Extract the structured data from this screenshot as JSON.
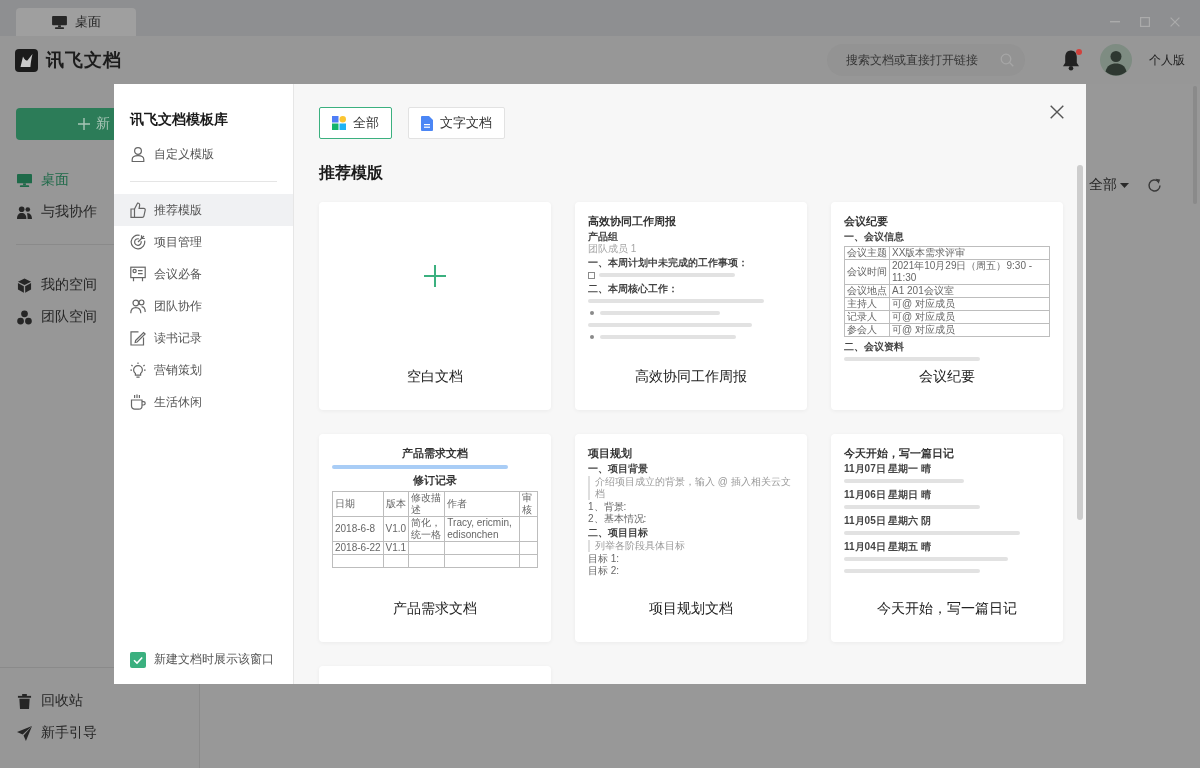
{
  "window": {
    "tab": {
      "label": "桌面"
    }
  },
  "header": {
    "app_name": "讯飞文档",
    "search": {
      "placeholder": "搜索文档或直接打开链接"
    },
    "notifications": {
      "unread": true
    },
    "account": "个人版"
  },
  "sidebar": {
    "new_button": {
      "label": "新"
    },
    "nav": [
      {
        "label": "桌面",
        "selected": true
      },
      {
        "label": "与我协作",
        "selected": false
      }
    ],
    "spaces": [
      {
        "label": "我的空间",
        "selected": false
      },
      {
        "label": "团队空间",
        "selected": false
      }
    ],
    "footer": [
      {
        "label": "回收站"
      },
      {
        "label": "新手引导"
      }
    ]
  },
  "main": {
    "filter": {
      "label": "全部"
    }
  },
  "dialog": {
    "title": "讯飞文档模板库",
    "custom": {
      "label": "自定义模版"
    },
    "categories": [
      {
        "label": "推荐模版",
        "selected": true
      },
      {
        "label": "项目管理",
        "selected": false
      },
      {
        "label": "会议必备",
        "selected": false
      },
      {
        "label": "团队协作",
        "selected": false
      },
      {
        "label": "读书记录",
        "selected": false
      },
      {
        "label": "营销策划",
        "selected": false
      },
      {
        "label": "生活休闲",
        "selected": false
      }
    ],
    "show_on_new": {
      "label": "新建文档时展示该窗口",
      "checked": true
    },
    "tabs": [
      {
        "label": "全部",
        "selected": true
      },
      {
        "label": "文字文档",
        "selected": false
      }
    ],
    "section_title": "推荐模版",
    "templates": [
      {
        "kind": "blank",
        "name": "空白文档"
      },
      {
        "kind": "doc",
        "name": "高效协同工作周报",
        "preview": [
          {
            "kind": "title",
            "text": "高效协同工作周报"
          },
          {
            "kind": "heading",
            "text": "产品组"
          },
          {
            "kind": "muted",
            "text": "团队成员 1"
          },
          {
            "kind": "heading",
            "text": "一、本周计划中未完成的工作事项："
          },
          {
            "kind": "check-bar"
          },
          {
            "kind": "heading",
            "text": "二、本周核心工作："
          },
          {
            "kind": "bar"
          },
          {
            "kind": "bullet-bar"
          },
          {
            "kind": "bar"
          },
          {
            "kind": "bullet-bar"
          }
        ]
      },
      {
        "kind": "doc",
        "name": "会议纪要",
        "preview": [
          {
            "kind": "title",
            "text": "会议纪要"
          },
          {
            "kind": "heading",
            "text": "一、会议信息"
          },
          {
            "kind": "table",
            "rows": [
              [
                "会议主题",
                "XX版本需求评审"
              ],
              [
                "会议时间",
                "2021年10月29日（周五）9:30 - 11:30"
              ],
              [
                "会议地点",
                "A1 201会议室"
              ],
              [
                "主持人",
                "可@ 对应成员"
              ],
              [
                "记录人",
                "可@ 对应成员"
              ],
              [
                "参会人",
                "可@ 对应成员"
              ]
            ]
          },
          {
            "kind": "heading",
            "text": "二、会议资料"
          },
          {
            "kind": "bar"
          }
        ]
      },
      {
        "kind": "doc",
        "name": "产品需求文档",
        "preview": [
          {
            "kind": "title-center",
            "text": "产品需求文档"
          },
          {
            "kind": "note-bar"
          },
          {
            "kind": "title-center",
            "text": "修订记录"
          },
          {
            "kind": "table",
            "rows": [
              [
                "日期",
                "版本",
                "修改描述",
                "作者",
                "审核"
              ],
              [
                "2018-6-8",
                "V1.0",
                "简化，统一格",
                "Tracy, ericmin, edisonchen",
                null
              ],
              [
                "2018-6-22",
                "V1.1",
                null,
                null,
                null
              ],
              [
                null,
                null,
                null,
                null,
                null
              ]
            ]
          }
        ]
      },
      {
        "kind": "doc",
        "name": "项目规划文档",
        "preview": [
          {
            "kind": "title",
            "text": "项目规划"
          },
          {
            "kind": "heading",
            "text": "一、项目背景"
          },
          {
            "kind": "quote",
            "text": "介绍项目成立的背景，输入 @ 插入相关云文档"
          },
          {
            "kind": "text",
            "text": "1、背景:"
          },
          {
            "kind": "text",
            "text": "2、基本情况:"
          },
          {
            "kind": "heading",
            "text": "二、项目目标"
          },
          {
            "kind": "quote",
            "text": "列举各阶段具体目标"
          },
          {
            "kind": "text",
            "text": "目标 1:"
          },
          {
            "kind": "text",
            "text": "目标 2:"
          }
        ]
      },
      {
        "kind": "doc",
        "name": "今天开始，写一篇日记",
        "preview": [
          {
            "kind": "title",
            "text": "今天开始，写一篇日记"
          },
          {
            "kind": "heading",
            "text": "11月07日 星期一 晴"
          },
          {
            "kind": "bar"
          },
          {
            "kind": "heading",
            "text": "11月06日 星期日 晴"
          },
          {
            "kind": "bar"
          },
          {
            "kind": "heading",
            "text": "11月05日 星期六 阴"
          },
          {
            "kind": "bar"
          },
          {
            "kind": "heading",
            "text": "11月04日 星期五 晴"
          },
          {
            "kind": "bar"
          },
          {
            "kind": "bar"
          }
        ]
      },
      {
        "kind": "partial"
      }
    ]
  }
}
